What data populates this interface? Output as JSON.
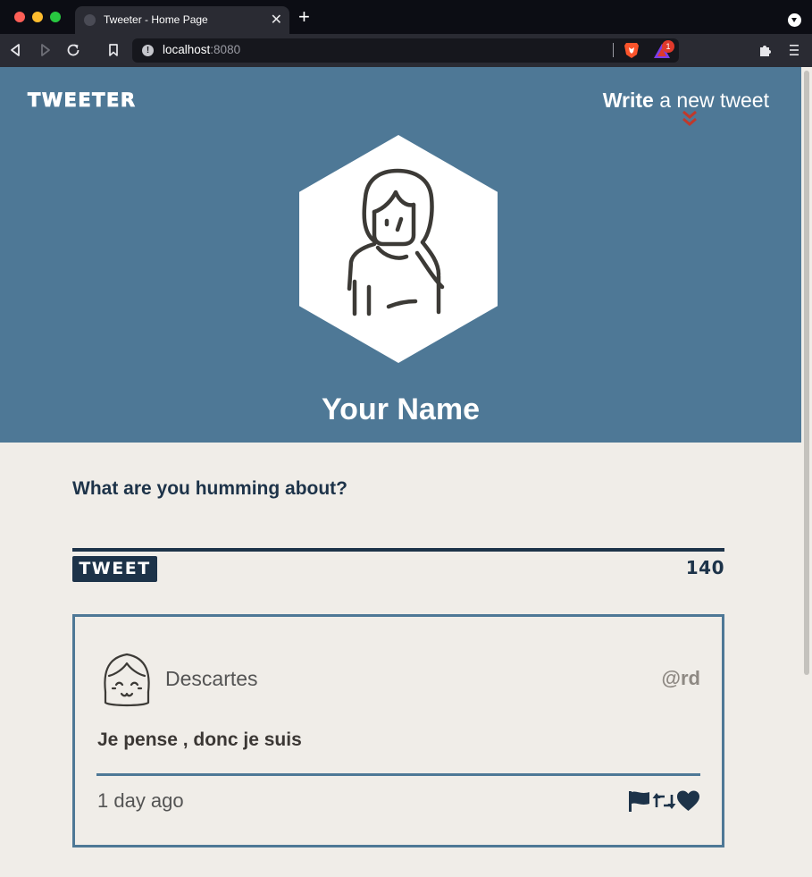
{
  "browser": {
    "tab_title": "Tweeter - Home Page",
    "tab_close": "✕",
    "new_tab": "+",
    "url_host": "localhost",
    "url_port": ":8080",
    "url_info": "!",
    "rewards_badge": "1"
  },
  "nav": {
    "logo": "TWEETER",
    "compose_strong": "Write",
    "compose_rest": " a new tweet"
  },
  "profile": {
    "name": "Your Name"
  },
  "composer": {
    "prompt": "What are you humming about?",
    "submit_label": "TWEET",
    "counter": "140"
  },
  "tweets": [
    {
      "author": "Descartes",
      "handle": "@rd",
      "text": "Je pense , donc je suis",
      "time": "1 day ago"
    }
  ],
  "colors": {
    "header_bg": "#4e7896",
    "page_bg": "#f0ede8",
    "navy": "#1d3349",
    "accent": "#c0392b"
  }
}
